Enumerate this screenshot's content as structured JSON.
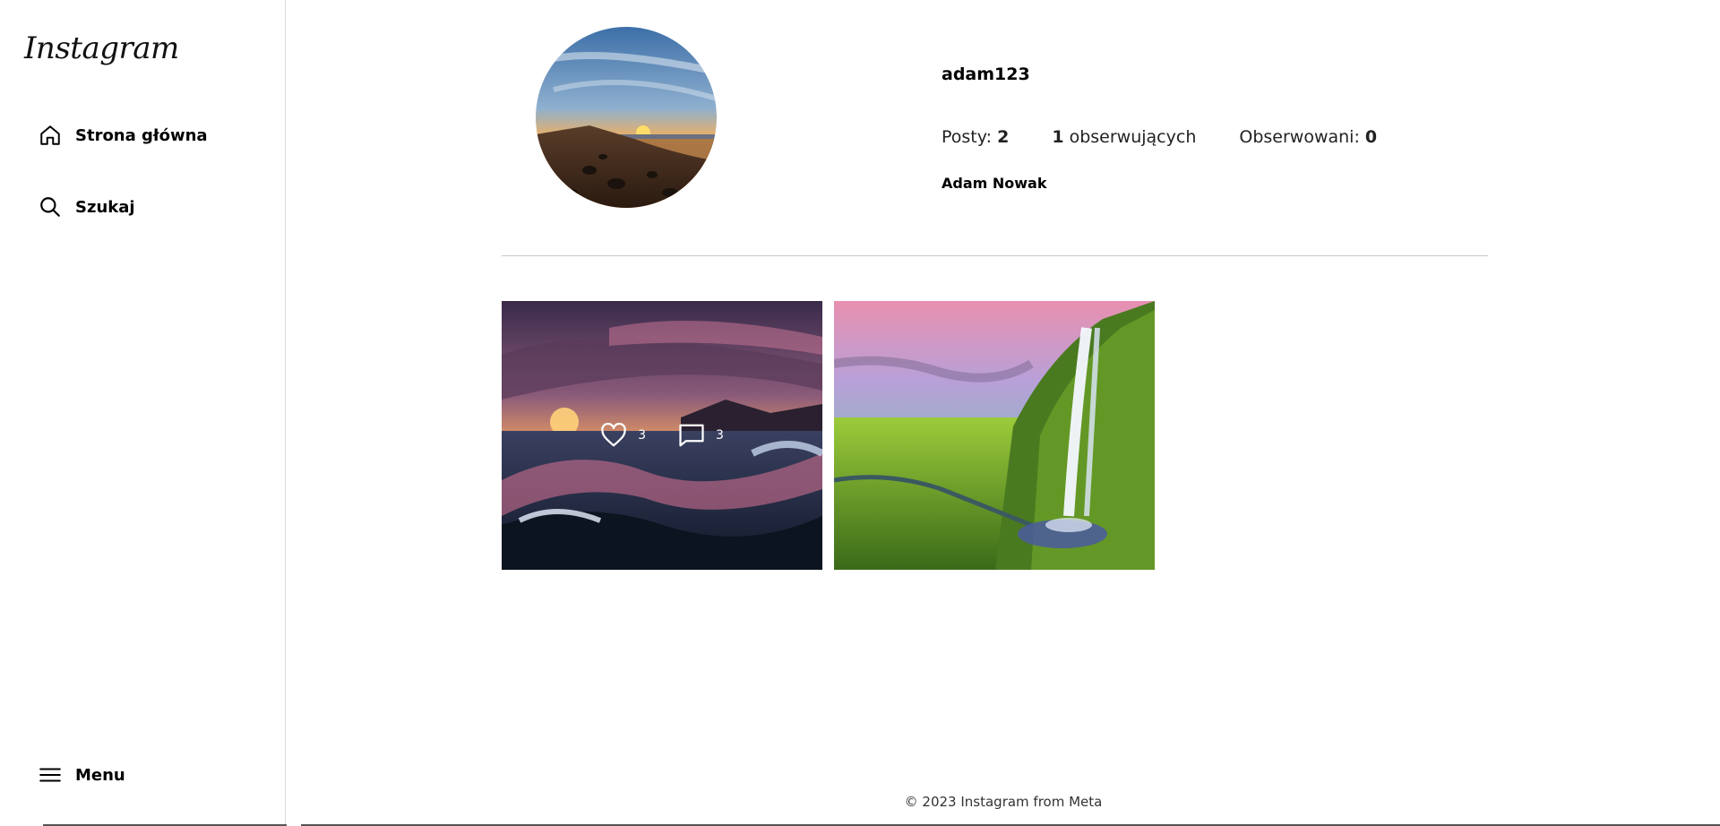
{
  "sidebar": {
    "logo": "Instagram",
    "items": [
      {
        "label": "Strona główna",
        "icon": "home-icon"
      },
      {
        "label": "Szukaj",
        "icon": "search-icon"
      }
    ],
    "menu": {
      "label": "Menu",
      "icon": "hamburger-icon"
    }
  },
  "profile": {
    "username": "adam123",
    "posts_label": "Posty:",
    "posts_count": "2",
    "followers_count": "1",
    "followers_label": "obserwujących",
    "following_label": "Obserwowani:",
    "following_count": "0",
    "full_name": "Adam Nowak"
  },
  "posts": [
    {
      "likes": "3",
      "comments": "3",
      "image": "ocean-sunset-waves"
    },
    {
      "image": "waterfall-green-valley"
    }
  ],
  "footer": {
    "text": "© 2023 Instagram from Meta"
  }
}
